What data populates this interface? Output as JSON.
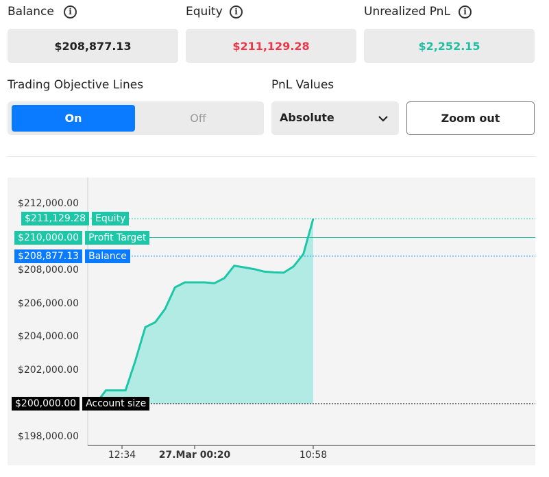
{
  "stats": {
    "balance": {
      "label": "Balance",
      "value": "$208,877.13",
      "color": "#222222"
    },
    "equity": {
      "label": "Equity",
      "value": "$211,129.28",
      "color": "#e8394a"
    },
    "unrealized": {
      "label": "Unrealized PnL",
      "value": "$2,252.15",
      "color": "#1fbfa3"
    }
  },
  "controls": {
    "objective_lines_label": "Trading Objective Lines",
    "on_label": "On",
    "off_label": "Off",
    "pnl_values_label": "PnL Values",
    "pnl_select_value": "Absolute",
    "zoom_out_label": "Zoom out"
  },
  "colors": {
    "accent": "#0a7bff",
    "teal": "#1cc7a8",
    "teal_fill": "#b1ebe3",
    "black": "#000000"
  },
  "chart_data": {
    "type": "area",
    "y_ticks": [
      "$212,000.00",
      "$208,000.00",
      "$206,000.00",
      "$204,000.00",
      "$202,000.00",
      "$198,000.00"
    ],
    "x_ticks": [
      "12:34",
      "27.Mar 00:20",
      "10:58"
    ],
    "ylim": [
      197500,
      213600
    ],
    "lines": [
      {
        "name": "Equity",
        "value": 211129.28,
        "label": "$211,129.28",
        "color": "#1cc7a8",
        "style": "dotted"
      },
      {
        "name": "Profit Target",
        "value": 210000.0,
        "label": "$210,000.00",
        "color": "#1cc7a8",
        "style": "solid"
      },
      {
        "name": "Balance",
        "value": 208877.13,
        "label": "$208,877.13",
        "color": "#0a7bff",
        "style": "dotted"
      },
      {
        "name": "Account size",
        "value": 200000.0,
        "label": "$200,000.00",
        "color": "#000000",
        "style": "dotted"
      }
    ],
    "series": [
      {
        "name": "Equity",
        "values": [
          200000,
          200800,
          200800,
          200800,
          202600,
          204600,
          204900,
          205700,
          207000,
          207300,
          207300,
          207300,
          207250,
          207550,
          208300,
          208200,
          208100,
          207950,
          207900,
          207880,
          208250,
          209000,
          211129.28
        ]
      }
    ]
  }
}
